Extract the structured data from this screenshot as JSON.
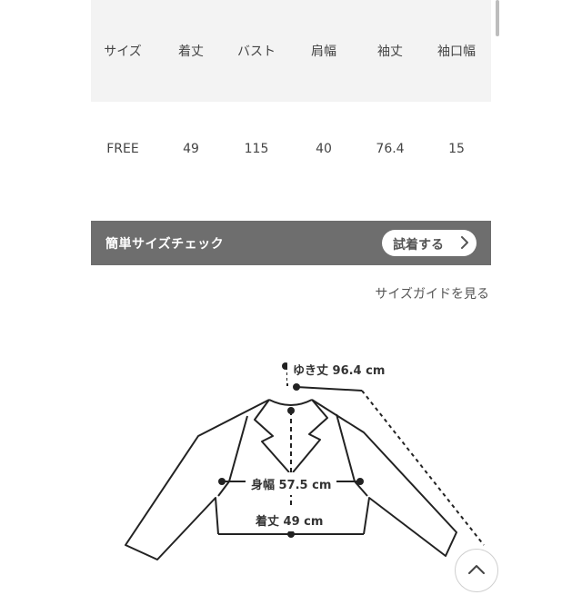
{
  "size_table": {
    "headers": [
      "サイズ",
      "着丈",
      "バスト",
      "肩幅",
      "袖丈",
      "袖口幅"
    ],
    "rows": [
      [
        "FREE",
        "49",
        "115",
        "40",
        "76.4",
        "15"
      ]
    ]
  },
  "size_check": {
    "title": "簡単サイズチェック",
    "button_label": "試着する",
    "button_icon": "chevron-right-icon"
  },
  "size_guide_link": "サイズガイドを見る",
  "diagram": {
    "sleeve_label": "ゆき丈 96.4 cm",
    "width_label": "身幅 57.5 cm",
    "length_label": "着丈 49 cm"
  },
  "scroll_top_icon": "chevron-up-icon",
  "colors": {
    "header_bg": "#f3f3f3",
    "check_bar_bg": "#6e6e6e",
    "line": "#222222"
  }
}
